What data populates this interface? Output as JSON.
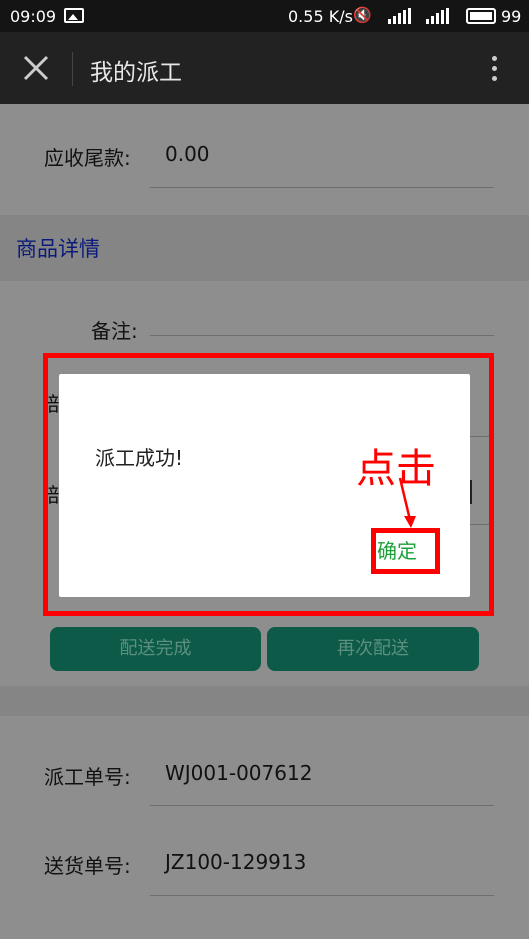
{
  "status": {
    "time": "09:09",
    "speed": "0.55 K/s",
    "battery": "99"
  },
  "appbar": {
    "title": "我的派工"
  },
  "content": {
    "balance_label": "应收尾款:",
    "balance_value": "0.00",
    "goods_section": "商品详情",
    "remark_label": "备注:",
    "partial_char": "部",
    "btn_delivered": "配送完成",
    "btn_redeliver": "再次配送",
    "dispatch_no_label": "派工单号:",
    "dispatch_no_value": "WJ001-007612",
    "delivery_no_label": "送货单号:",
    "delivery_no_value": "JZ100-129913"
  },
  "dialog": {
    "message": "派工成功!",
    "confirm": "确定"
  },
  "annotation": {
    "text": "点击",
    "color": "#ff0000"
  }
}
